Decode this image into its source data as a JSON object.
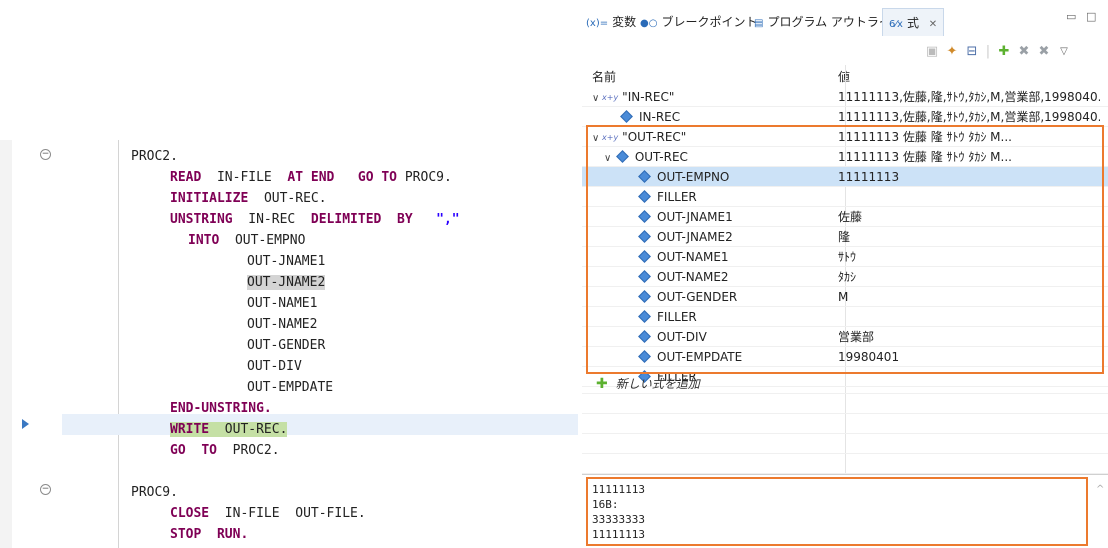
{
  "editor": {
    "lines": [
      [
        {
          "t": "PROC2."
        }
      ],
      [
        {
          "t": "READ",
          "c": "kw"
        },
        {
          "t": "  "
        },
        {
          "t": "IN-FILE"
        },
        {
          "t": "  "
        },
        {
          "t": "AT",
          "c": "kw"
        },
        {
          "t": " "
        },
        {
          "t": "END",
          "c": "kw"
        },
        {
          "t": "   "
        },
        {
          "t": "GO",
          "c": "kw"
        },
        {
          "t": " "
        },
        {
          "t": "TO",
          "c": "kw"
        },
        {
          "t": " "
        },
        {
          "t": "PROC9."
        }
      ],
      [
        {
          "t": "INITIALIZE",
          "c": "kw"
        },
        {
          "t": "  "
        },
        {
          "t": "OUT-REC."
        }
      ],
      [
        {
          "t": "UNSTRING",
          "c": "kw"
        },
        {
          "t": "  "
        },
        {
          "t": "IN-REC"
        },
        {
          "t": "  "
        },
        {
          "t": "DELIMITED",
          "c": "kw"
        },
        {
          "t": "  "
        },
        {
          "t": "BY",
          "c": "kw"
        },
        {
          "t": "   "
        },
        {
          "t": "\",\"",
          "c": "str"
        }
      ],
      [
        {
          "t": "INTO",
          "c": "kw"
        },
        {
          "t": "  "
        },
        {
          "t": "OUT-EMPNO"
        }
      ],
      [
        {
          "t": "OUT-JNAME1"
        }
      ],
      [
        {
          "t": "OUT-JNAME2",
          "c": "hl-gray"
        }
      ],
      [
        {
          "t": "OUT-NAME1"
        }
      ],
      [
        {
          "t": "OUT-NAME2"
        }
      ],
      [
        {
          "t": "OUT-GENDER"
        }
      ],
      [
        {
          "t": "OUT-DIV"
        }
      ],
      [
        {
          "t": "OUT-EMPDATE"
        }
      ],
      [
        {
          "t": "END-UNSTRING.",
          "c": "kw"
        }
      ],
      [
        {
          "t": "WRITE",
          "c": "kw hl-green"
        },
        {
          "t": "  ",
          "c": "hl-green"
        },
        {
          "t": "OUT-REC.",
          "c": "hl-green"
        }
      ],
      [
        {
          "t": "GO",
          "c": "kw"
        },
        {
          "t": "  "
        },
        {
          "t": "TO",
          "c": "kw"
        },
        {
          "t": "  "
        },
        {
          "t": "PROC2."
        }
      ],
      [
        {
          "t": "PROC9."
        }
      ],
      [
        {
          "t": "CLOSE",
          "c": "kw"
        },
        {
          "t": "  "
        },
        {
          "t": "IN-FILE"
        },
        {
          "t": "  "
        },
        {
          "t": "OUT-FILE."
        }
      ],
      [
        {
          "t": "STOP",
          "c": "kw"
        },
        {
          "t": "  "
        },
        {
          "t": "RUN.",
          "c": "kw"
        }
      ]
    ]
  },
  "expressions_view": {
    "tabs": [
      {
        "icon": "(x)=",
        "label": "変数"
      },
      {
        "icon": "●○",
        "label": "ブレークポイント"
      },
      {
        "icon": "▤",
        "label": "プログラム アウトライン"
      },
      {
        "icon": "6⁄x",
        "label": "式",
        "close": "✕"
      }
    ],
    "columns": {
      "name": "名前",
      "value": "値"
    },
    "rows": [
      {
        "name": "\"IN-REC\"",
        "value": "11111113,佐藤,隆,ｻﾄｳ,ﾀｶｼ,M,営業部,1998040..."
      },
      {
        "name": "IN-REC",
        "value": "11111113,佐藤,隆,ｻﾄｳ,ﾀｶｼ,M,営業部,1998040..."
      },
      {
        "name": "\"OUT-REC\"",
        "value": "11111113 佐藤        隆             ｻﾄｳ  ﾀｶｼ  M..."
      },
      {
        "name": "OUT-REC",
        "value": "11111113 佐藤        隆             ｻﾄｳ  ﾀｶｼ  M..."
      },
      {
        "name": "OUT-EMPNO",
        "value": "11111113"
      },
      {
        "name": "FILLER",
        "value": ""
      },
      {
        "name": "OUT-JNAME1",
        "value": "佐藤"
      },
      {
        "name": "OUT-JNAME2",
        "value": "隆"
      },
      {
        "name": "OUT-NAME1",
        "value": "ｻﾄｳ"
      },
      {
        "name": "OUT-NAME2",
        "value": "ﾀｶｼ"
      },
      {
        "name": "OUT-GENDER",
        "value": "M"
      },
      {
        "name": "FILLER",
        "value": ""
      },
      {
        "name": "OUT-DIV",
        "value": "営業部"
      },
      {
        "name": "OUT-EMPDATE",
        "value": "19980401"
      },
      {
        "name": "FILLER",
        "value": ""
      }
    ],
    "add_expression_label": "新しい式を追加",
    "detail_text": "11111113\n16B:\n33333333\n11111113"
  },
  "colors": {
    "keyword": "#7f0055",
    "string": "#2a00ff",
    "highlight_box": "#ec7a2e",
    "selected_row": "#cce2f7"
  }
}
